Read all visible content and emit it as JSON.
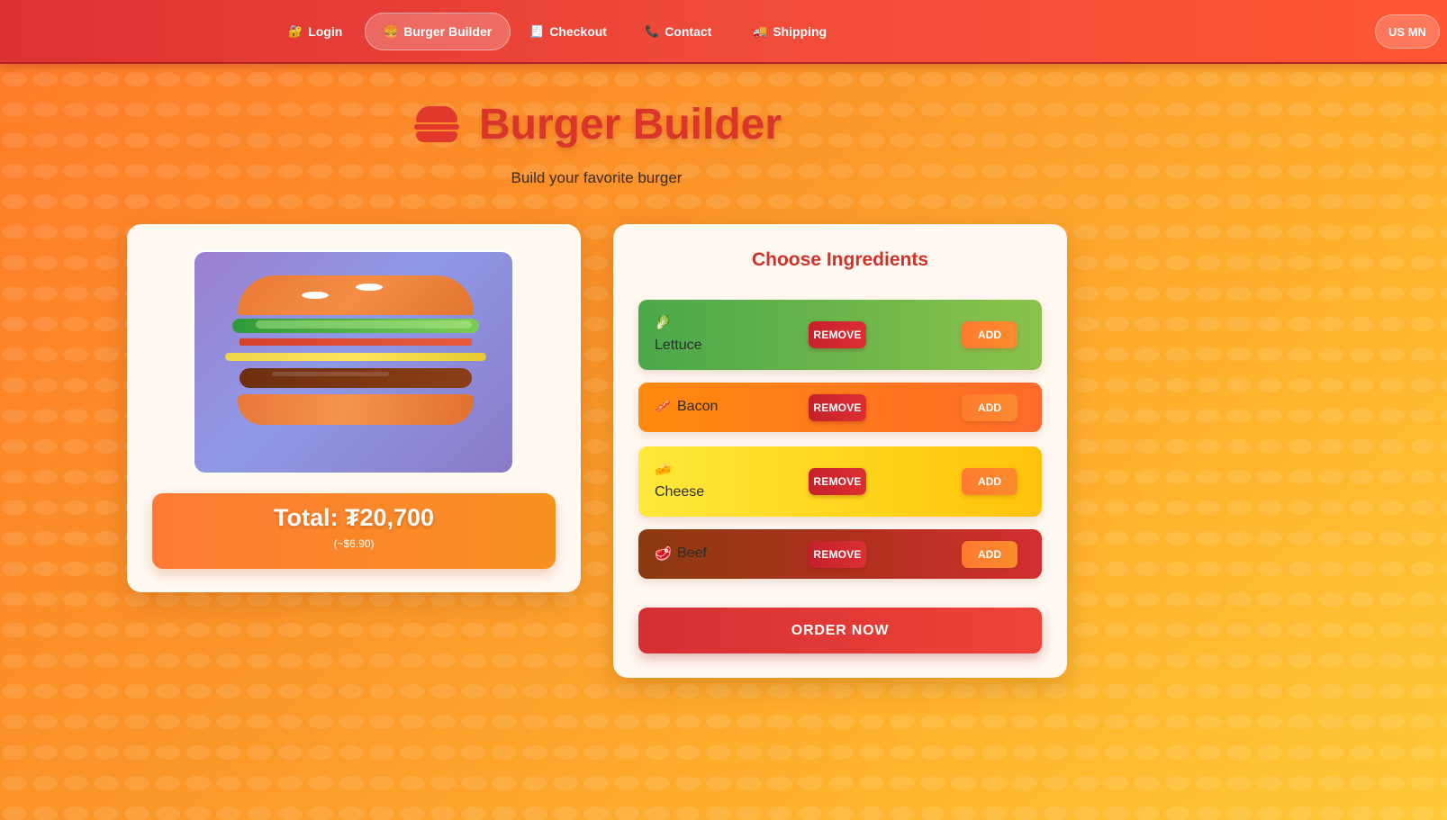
{
  "nav": {
    "items": [
      {
        "icon": "🔐",
        "icon_name": "lock-icon",
        "label": "Login"
      },
      {
        "icon": "🍔",
        "icon_name": "burger-icon",
        "label": "Burger Builder"
      },
      {
        "icon": "🧾",
        "icon_name": "receipt-icon",
        "label": "Checkout"
      },
      {
        "icon": "📞",
        "icon_name": "phone-icon",
        "label": "Contact"
      },
      {
        "icon": "🚚",
        "icon_name": "truck-icon",
        "label": "Shipping"
      }
    ],
    "active_index": 1,
    "language_label": "US MN"
  },
  "header": {
    "title": "Burger Builder",
    "subtitle": "Build your favorite burger"
  },
  "summary": {
    "total_label": "Total: ₮20,700",
    "total_usd": "(~$6.90)"
  },
  "ingredients": {
    "title": "Choose Ingredients",
    "items": [
      {
        "icon": "🥬",
        "name": "Lettuce",
        "remove_label": "REMOVE",
        "add_label": "ADD"
      },
      {
        "icon": "🥓",
        "name": "Bacon",
        "remove_label": "REMOVE",
        "add_label": "ADD"
      },
      {
        "icon": "🧀",
        "name": "Cheese",
        "remove_label": "REMOVE",
        "add_label": "ADD"
      },
      {
        "icon": "🥩",
        "name": "Beef",
        "remove_label": "REMOVE",
        "add_label": "ADD"
      }
    ],
    "order_label": "ORDER NOW"
  },
  "colors": {
    "accent": "#d9352b",
    "nav_start": "#dc3232",
    "nav_end": "#ff5733",
    "lettuce_row": "#5cb54a",
    "bacon_row": "#ff7a1a",
    "cheese_row": "#ffd52a",
    "beef_row": "#b0321f"
  }
}
